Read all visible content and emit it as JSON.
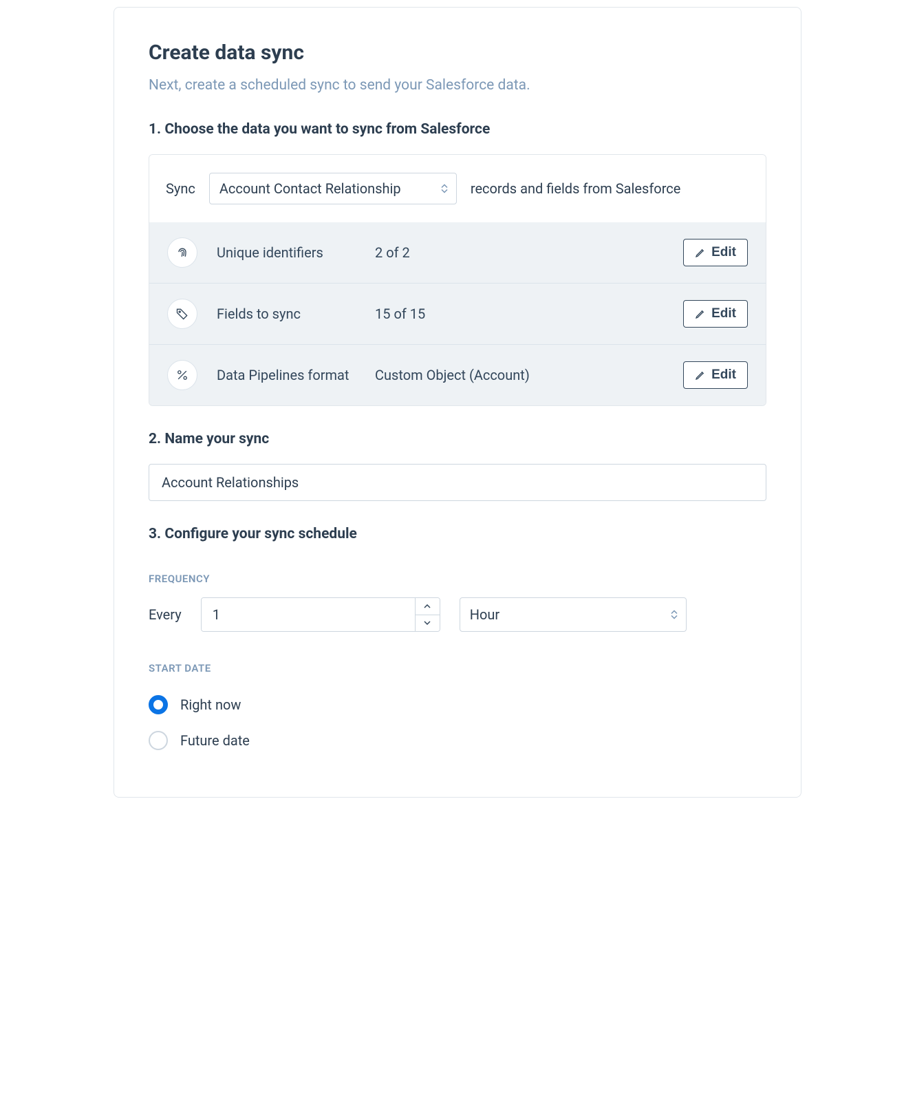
{
  "title": "Create data sync",
  "subtitle": "Next, create a scheduled sync to send your Salesforce data.",
  "step1": {
    "heading": "1. Choose the data you want to sync from Salesforce",
    "prefix": "Sync",
    "object_select": "Account Contact Relationship",
    "suffix": "records and fields from Salesforce",
    "rows": {
      "uid": {
        "label": "Unique identifiers",
        "value": "2 of 2",
        "button": "Edit"
      },
      "fields": {
        "label": "Fields to sync",
        "value": "15 of 15",
        "button": "Edit"
      },
      "format": {
        "label": "Data Pipelines format",
        "value": "Custom Object (Account)",
        "button": "Edit"
      }
    }
  },
  "step2": {
    "heading": "2. Name your sync",
    "value": "Account Relationships"
  },
  "step3": {
    "heading": "3. Configure your sync schedule",
    "frequency_label": "FREQUENCY",
    "every": "Every",
    "interval": "1",
    "unit": "Hour",
    "startdate_label": "START DATE",
    "option_now": "Right now",
    "option_future": "Future date"
  }
}
